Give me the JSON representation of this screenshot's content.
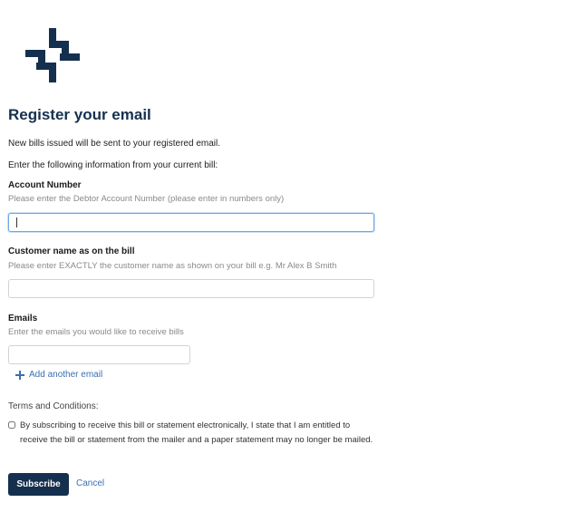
{
  "page": {
    "title": "Register your email",
    "intro_line1": "New bills issued will be sent to your registered email.",
    "intro_line2": "Enter the following information from your current bill:"
  },
  "fields": {
    "account_number": {
      "label": "Account Number",
      "hint": "Please enter the Debtor Account Number (please enter in numbers only)",
      "value": ""
    },
    "customer_name": {
      "label": "Customer name as on the bill",
      "hint": "Please enter EXACTLY the customer name as shown on your bill e.g. Mr Alex B Smith",
      "value": ""
    },
    "emails": {
      "label": "Emails",
      "hint": "Enter the emails you would like to receive bills",
      "value": "",
      "add_link": "Add another email"
    }
  },
  "terms": {
    "heading": "Terms and Conditions:",
    "text": "By subscribing to receive this bill or statement electronically, I state that I am entitled to receive the bill or statement from the mailer and a paper statement may no longer be mailed.",
    "checked": false
  },
  "actions": {
    "subscribe": "Subscribe",
    "cancel": "Cancel"
  },
  "colors": {
    "brand": "#15304f",
    "link": "#3a6fb0",
    "focus_border": "#6aa7e8"
  }
}
